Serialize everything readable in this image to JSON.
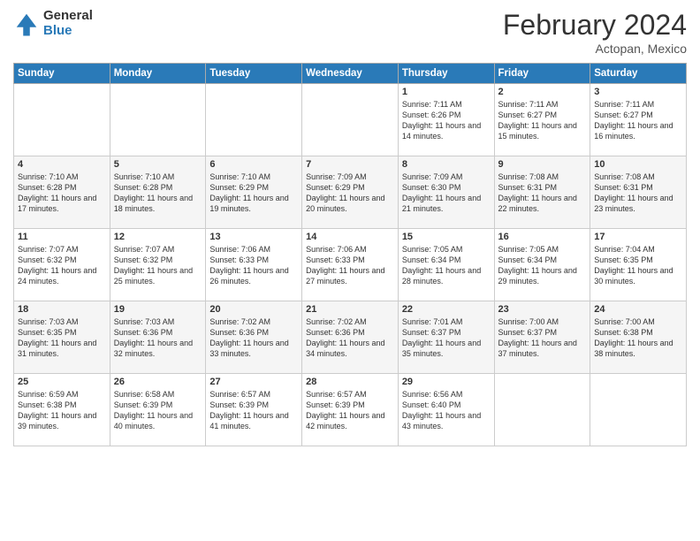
{
  "logo": {
    "general": "General",
    "blue": "Blue"
  },
  "header": {
    "title": "February 2024",
    "subtitle": "Actopan, Mexico"
  },
  "days_of_week": [
    "Sunday",
    "Monday",
    "Tuesday",
    "Wednesday",
    "Thursday",
    "Friday",
    "Saturday"
  ],
  "weeks": [
    [
      {
        "day": "",
        "info": ""
      },
      {
        "day": "",
        "info": ""
      },
      {
        "day": "",
        "info": ""
      },
      {
        "day": "",
        "info": ""
      },
      {
        "day": "1",
        "info": "Sunrise: 7:11 AM\nSunset: 6:26 PM\nDaylight: 11 hours and 14 minutes."
      },
      {
        "day": "2",
        "info": "Sunrise: 7:11 AM\nSunset: 6:27 PM\nDaylight: 11 hours and 15 minutes."
      },
      {
        "day": "3",
        "info": "Sunrise: 7:11 AM\nSunset: 6:27 PM\nDaylight: 11 hours and 16 minutes."
      }
    ],
    [
      {
        "day": "4",
        "info": "Sunrise: 7:10 AM\nSunset: 6:28 PM\nDaylight: 11 hours and 17 minutes."
      },
      {
        "day": "5",
        "info": "Sunrise: 7:10 AM\nSunset: 6:28 PM\nDaylight: 11 hours and 18 minutes."
      },
      {
        "day": "6",
        "info": "Sunrise: 7:10 AM\nSunset: 6:29 PM\nDaylight: 11 hours and 19 minutes."
      },
      {
        "day": "7",
        "info": "Sunrise: 7:09 AM\nSunset: 6:29 PM\nDaylight: 11 hours and 20 minutes."
      },
      {
        "day": "8",
        "info": "Sunrise: 7:09 AM\nSunset: 6:30 PM\nDaylight: 11 hours and 21 minutes."
      },
      {
        "day": "9",
        "info": "Sunrise: 7:08 AM\nSunset: 6:31 PM\nDaylight: 11 hours and 22 minutes."
      },
      {
        "day": "10",
        "info": "Sunrise: 7:08 AM\nSunset: 6:31 PM\nDaylight: 11 hours and 23 minutes."
      }
    ],
    [
      {
        "day": "11",
        "info": "Sunrise: 7:07 AM\nSunset: 6:32 PM\nDaylight: 11 hours and 24 minutes."
      },
      {
        "day": "12",
        "info": "Sunrise: 7:07 AM\nSunset: 6:32 PM\nDaylight: 11 hours and 25 minutes."
      },
      {
        "day": "13",
        "info": "Sunrise: 7:06 AM\nSunset: 6:33 PM\nDaylight: 11 hours and 26 minutes."
      },
      {
        "day": "14",
        "info": "Sunrise: 7:06 AM\nSunset: 6:33 PM\nDaylight: 11 hours and 27 minutes."
      },
      {
        "day": "15",
        "info": "Sunrise: 7:05 AM\nSunset: 6:34 PM\nDaylight: 11 hours and 28 minutes."
      },
      {
        "day": "16",
        "info": "Sunrise: 7:05 AM\nSunset: 6:34 PM\nDaylight: 11 hours and 29 minutes."
      },
      {
        "day": "17",
        "info": "Sunrise: 7:04 AM\nSunset: 6:35 PM\nDaylight: 11 hours and 30 minutes."
      }
    ],
    [
      {
        "day": "18",
        "info": "Sunrise: 7:03 AM\nSunset: 6:35 PM\nDaylight: 11 hours and 31 minutes."
      },
      {
        "day": "19",
        "info": "Sunrise: 7:03 AM\nSunset: 6:36 PM\nDaylight: 11 hours and 32 minutes."
      },
      {
        "day": "20",
        "info": "Sunrise: 7:02 AM\nSunset: 6:36 PM\nDaylight: 11 hours and 33 minutes."
      },
      {
        "day": "21",
        "info": "Sunrise: 7:02 AM\nSunset: 6:36 PM\nDaylight: 11 hours and 34 minutes."
      },
      {
        "day": "22",
        "info": "Sunrise: 7:01 AM\nSunset: 6:37 PM\nDaylight: 11 hours and 35 minutes."
      },
      {
        "day": "23",
        "info": "Sunrise: 7:00 AM\nSunset: 6:37 PM\nDaylight: 11 hours and 37 minutes."
      },
      {
        "day": "24",
        "info": "Sunrise: 7:00 AM\nSunset: 6:38 PM\nDaylight: 11 hours and 38 minutes."
      }
    ],
    [
      {
        "day": "25",
        "info": "Sunrise: 6:59 AM\nSunset: 6:38 PM\nDaylight: 11 hours and 39 minutes."
      },
      {
        "day": "26",
        "info": "Sunrise: 6:58 AM\nSunset: 6:39 PM\nDaylight: 11 hours and 40 minutes."
      },
      {
        "day": "27",
        "info": "Sunrise: 6:57 AM\nSunset: 6:39 PM\nDaylight: 11 hours and 41 minutes."
      },
      {
        "day": "28",
        "info": "Sunrise: 6:57 AM\nSunset: 6:39 PM\nDaylight: 11 hours and 42 minutes."
      },
      {
        "day": "29",
        "info": "Sunrise: 6:56 AM\nSunset: 6:40 PM\nDaylight: 11 hours and 43 minutes."
      },
      {
        "day": "",
        "info": ""
      },
      {
        "day": "",
        "info": ""
      }
    ]
  ]
}
